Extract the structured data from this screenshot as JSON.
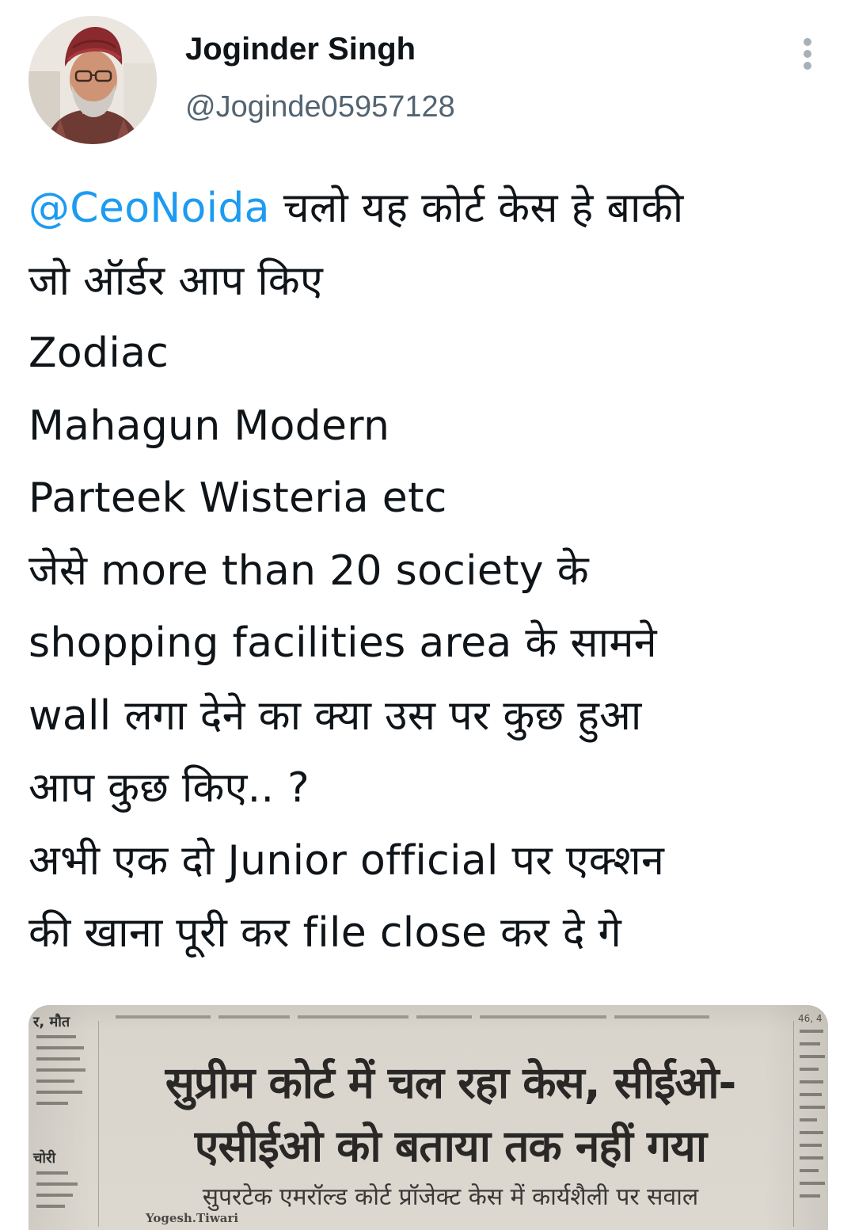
{
  "header": {
    "display_name": "Joginder Singh",
    "handle": "@Joginde05957128",
    "more_icon": "more-vertical-icon"
  },
  "tweet": {
    "mention": "@CeoNoida",
    "line1_rest": " चलो यह कोर्ट केस हे बाकी",
    "lines": [
      "जो ऑर्डर आप किए",
      "Zodiac",
      "Mahagun Modern",
      "Parteek Wisteria etc",
      "जेसे more than 20 society के",
      "shopping facilities area के सामने",
      "wall लगा देने का क्या उस पर कुछ हुआ",
      "आप कुछ किए.. ?",
      "अभी एक दो Junior official पर एक्शन",
      "की खाना पूरी कर file close कर दे गे"
    ]
  },
  "media": {
    "left_col_heading": "र, मौत",
    "left_col_heading2": "चोरी",
    "right_col_top": "46, 4",
    "headline_line1": "सुप्रीम कोर्ट में चल रहा केस, सीईओ-",
    "headline_line2": "एसीईओ को बताया तक नहीं गया",
    "subheadline": "सुपरटेक एमरॉल्ड कोर्ट प्रॉजेक्ट केस में कार्यशैली पर सवाल",
    "byline": "Yogesh.Tiwari"
  },
  "colors": {
    "link": "#1d9bf0",
    "text": "#0f1419",
    "secondary": "#536471",
    "background": "#ffffff"
  }
}
